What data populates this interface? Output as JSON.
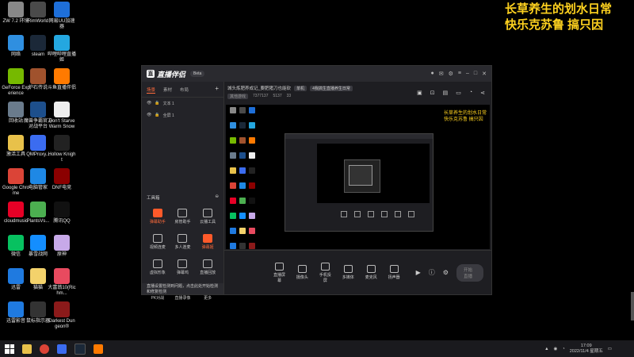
{
  "overlay": {
    "line1": "长草养生的划水日常",
    "line2": "快乐克苏鲁  搞只因"
  },
  "desktop_icons": [
    {
      "label": "ZW 7.2 环境",
      "icon": "text-logo-icon",
      "color": "#888888"
    },
    {
      "label": "RimWorld",
      "icon": "rimworld-icon",
      "color": "#4a4a4a"
    },
    {
      "label": "网易UU加速器",
      "icon": "uu-icon",
      "color": "#1e6fd9"
    },
    {
      "label": "网络",
      "icon": "network-icon",
      "color": "#2f8fe0"
    },
    {
      "label": "steam",
      "icon": "steam-icon",
      "color": "#1b2838"
    },
    {
      "label": "哔哩哔哩直播姬",
      "icon": "bilibili-live-icon",
      "color": "#24a7e0"
    },
    {
      "label": "GeForce Experience",
      "icon": "geforce-icon",
      "color": "#76b900"
    },
    {
      "label": "炉石传说",
      "icon": "hearthstone-icon",
      "color": "#a0522d"
    },
    {
      "label": "斗鱼直播伴侣",
      "icon": "douyu-icon",
      "color": "#ff7a00"
    },
    {
      "label": "回收站",
      "icon": "recycle-bin-icon",
      "color": "#6a7b8c"
    },
    {
      "label": "魔兽争霸官方对战平台",
      "icon": "warcraft-icon",
      "color": "#1d4f8c"
    },
    {
      "label": "Don't Starve Warm Snow",
      "icon": "document-icon",
      "color": "#eeeeee"
    },
    {
      "label": "激活工具",
      "icon": "folder-icon",
      "color": "#e8c14a"
    },
    {
      "label": "QMProxy...",
      "icon": "qmproxy-icon",
      "color": "#3b6cf0"
    },
    {
      "label": "Hollow Knight",
      "icon": "hollow-knight-icon",
      "color": "#222222"
    },
    {
      "label": "Google Chrome",
      "icon": "chrome-icon",
      "color": "#db4437"
    },
    {
      "label": "电脑管家",
      "icon": "pc-manager-icon",
      "color": "#1e88e5"
    },
    {
      "label": "DNF电竞",
      "icon": "dnf-icon",
      "color": "#8b0000"
    },
    {
      "label": "cloudmusic",
      "icon": "cloudmusic-icon",
      "color": "#e60026"
    },
    {
      "label": "PlantsVs...",
      "icon": "pvz-icon",
      "color": "#4caf50"
    },
    {
      "label": "腾讯QQ",
      "icon": "qq-icon",
      "color": "#111111"
    },
    {
      "label": "微信",
      "icon": "wechat-icon",
      "color": "#07c160"
    },
    {
      "label": "暴雪战网",
      "icon": "battlenet-icon",
      "color": "#148eff"
    },
    {
      "label": "原神",
      "icon": "genshin-icon",
      "color": "#c7a9e8"
    },
    {
      "label": "迅雷",
      "icon": "xunlei-icon",
      "color": "#1f7ae0"
    },
    {
      "label": "猫猫",
      "icon": "cat-icon",
      "color": "#f3d26b"
    },
    {
      "label": "大富翁10(Richm...",
      "icon": "richman-icon",
      "color": "#e84a5f"
    },
    {
      "label": "迅雷影音",
      "icon": "xunlei-player-icon",
      "color": "#1f7ae0"
    },
    {
      "label": "鼠标指示器",
      "icon": "mouse-icon",
      "color": "#333333"
    },
    {
      "label": "Darkest Dungeon®",
      "icon": "darkest-dungeon-icon",
      "color": "#8b1a1a"
    }
  ],
  "app": {
    "title": "直播伴侣",
    "version": "Beta",
    "left_tabs": [
      "场景",
      "素材",
      "布局"
    ],
    "scenes": [
      "文本 1",
      "全屏 1"
    ],
    "tools_title": "工具箱",
    "tools": [
      {
        "label": "弹幕助手",
        "hot": true
      },
      {
        "label": "房管助手",
        "hot": false
      },
      {
        "label": "云播工具",
        "hot": false
      },
      {
        "label": "视频连麦",
        "hot": false
      },
      {
        "label": "多人连麦",
        "hot": false
      },
      {
        "label": "弹幕姬",
        "hot": true
      },
      {
        "label": "虚拟形象",
        "hot": false
      },
      {
        "label": "弹幕鸡",
        "hot": false
      },
      {
        "label": "直播回放",
        "hot": false
      },
      {
        "label": "PK对战",
        "hot": false
      },
      {
        "label": "直播录像",
        "hot": false
      },
      {
        "label": "更多",
        "hot": false
      }
    ],
    "notice": "直播设置检测到问题，点击此处开始检测和修复检测",
    "room_title": "城头炼肥养成记_要肥猪刀也能砍",
    "tag1": "单机",
    "tag2": "4我搞生直播养生日常",
    "category": "其他游戏",
    "stats": [
      "7377137",
      "5137",
      "33"
    ],
    "bottom_tools": [
      "直播屏幕",
      "摄像头",
      "手机投屏",
      "多媒体",
      "麦克风",
      "扬声器"
    ],
    "start_button": "开始直播"
  },
  "preview_overlay": {
    "line1": "长草养生的划水日常",
    "line2": "快乐克苏鲁  搞只因"
  },
  "taskbar": {
    "time": "17:09",
    "date": "2022/11/4 星期五"
  }
}
